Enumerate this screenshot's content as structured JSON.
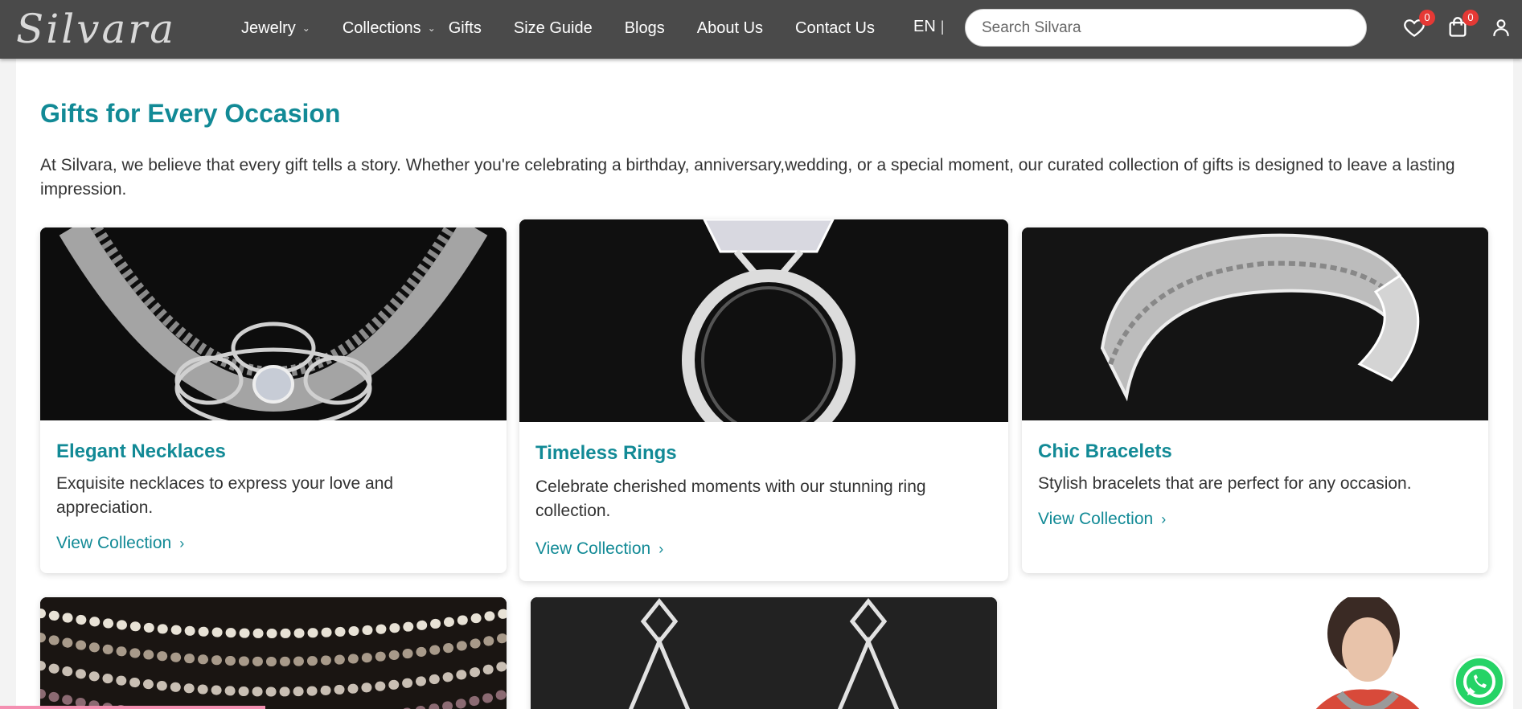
{
  "header": {
    "logo": "Silvara",
    "nav": [
      {
        "label": "Jewelry",
        "dropdown": true
      },
      {
        "label": "Collections",
        "dropdown": true
      },
      {
        "label": "Gifts",
        "dropdown": false
      },
      {
        "label": "Size Guide",
        "dropdown": false
      },
      {
        "label": "Blogs",
        "dropdown": false
      },
      {
        "label": "About Us",
        "dropdown": false
      },
      {
        "label": "Contact Us",
        "dropdown": false
      }
    ],
    "language": "EN",
    "search_placeholder": "Search Silvara",
    "wishlist_count": "0",
    "cart_count": "0",
    "icons": [
      "heart-icon",
      "shopping-bag-icon",
      "user-icon"
    ]
  },
  "page": {
    "title": "Gifts for Every Occasion",
    "intro": "At Silvara, we believe that every gift tells a story. Whether you're celebrating a birthday, anniversary,wedding, or a special moment, our curated collection of gifts is designed to leave a lasting impression."
  },
  "cards": [
    {
      "title": "Elegant Necklaces",
      "desc": "Exquisite necklaces to express your love and appreciation.",
      "link": "View Collection",
      "image": "silver-necklace-image"
    },
    {
      "title": "Timeless Rings",
      "desc": "Celebrate cherished moments with our stunning ring collection.",
      "link": "View Collection",
      "image": "silver-ring-image"
    },
    {
      "title": "Chic Bracelets",
      "desc": "Stylish bracelets that are perfect for any occasion.",
      "link": "View Collection",
      "image": "silver-cuff-bracelet-image"
    }
  ],
  "colors": {
    "header_bg": "#4a4a4a",
    "accent": "#128a96",
    "badge": "#e53935",
    "whatsapp": "#25d366"
  }
}
